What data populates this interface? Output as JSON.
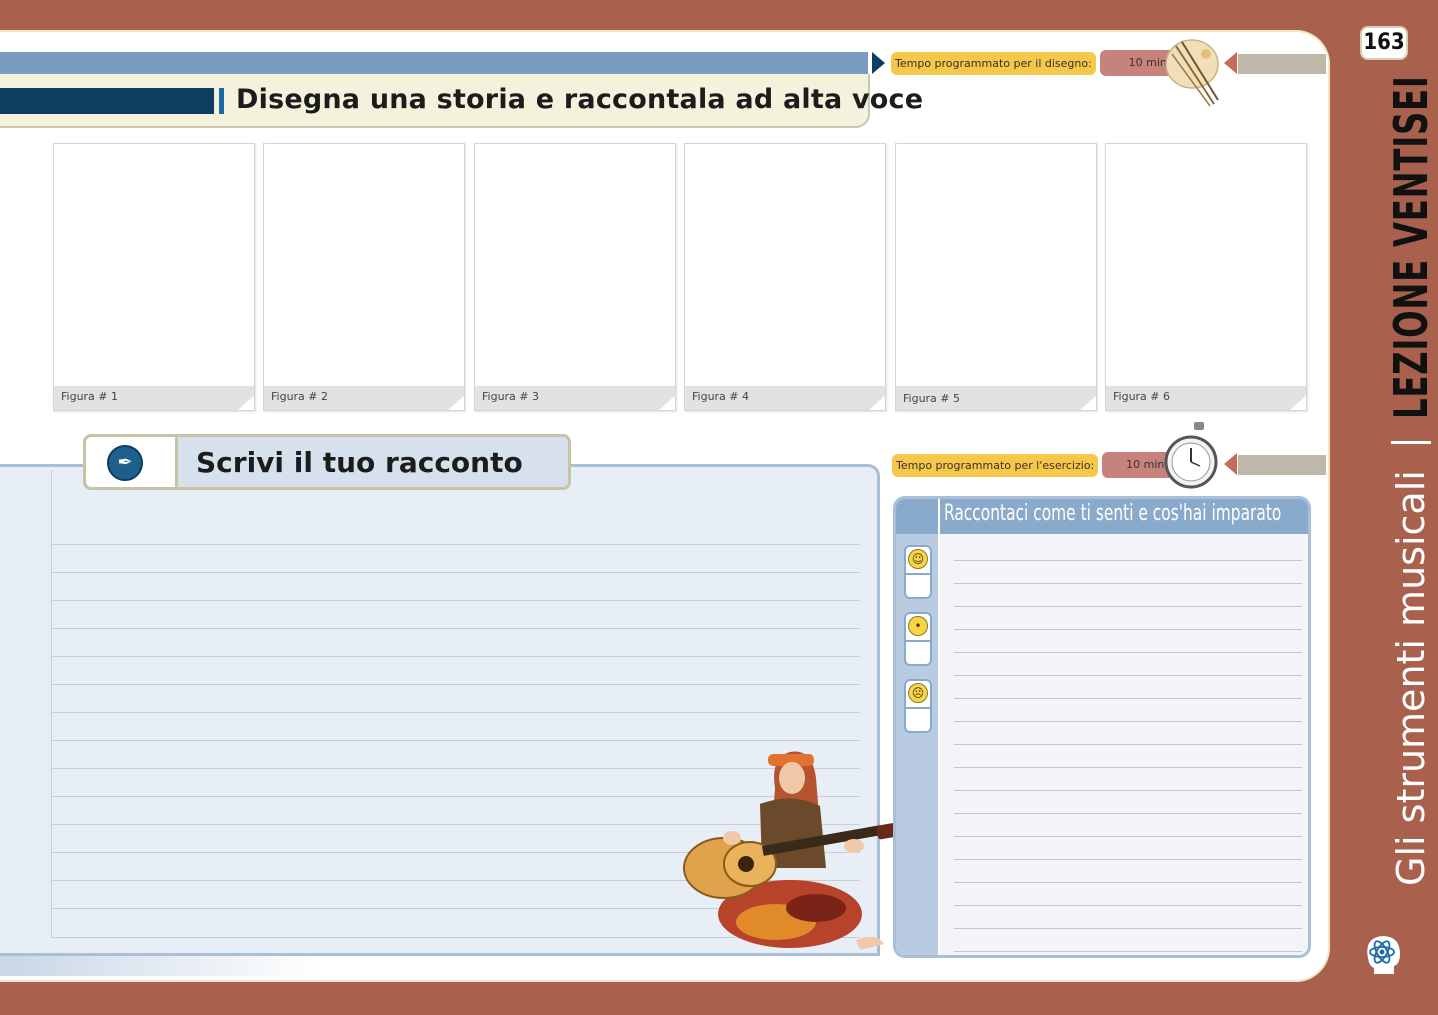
{
  "page_number": "163",
  "drawing_section": {
    "title": "Disegna una storia e raccontala ad alta voce",
    "time_label": "Tempo programmato per il disegno:",
    "time_value": "10 min",
    "panels": [
      "Figura # 1",
      "Figura # 2",
      "Figura # 3",
      "Figura # 4",
      "Figura # 5",
      "Figura # 6"
    ]
  },
  "writing_section": {
    "title": "Scrivi il tuo racconto",
    "icon": "pen-nib-icon"
  },
  "feelings_section": {
    "time_label": "Tempo programmato per l'esercizio:",
    "time_value": "10 min",
    "title": "Raccontaci come ti senti e cos'hai imparato",
    "emoticons": [
      "happy-face-icon",
      "neutral-face-icon",
      "sad-face-icon"
    ]
  },
  "sidebar": {
    "lesson": "LEZIONE VENTISEI",
    "topic": "Gli strumenti musicali",
    "separator": "|"
  },
  "colors": {
    "frame": "#a9604d",
    "title_dark": "#0b3e60",
    "accent_blue": "#7b9cc1",
    "time_yellow": "#f7c74a",
    "time_pink": "#c8827c"
  }
}
